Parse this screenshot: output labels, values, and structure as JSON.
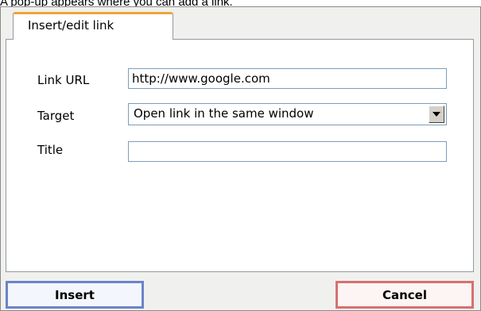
{
  "caption": "A pop-up appears where you can add a link.",
  "tabs": [
    {
      "label": "Insert/edit link",
      "active": true
    }
  ],
  "form": {
    "link_url_label": "Link URL",
    "link_url_value": "http://www.google.com",
    "target_label": "Target",
    "target_value": "Open link in the same window",
    "title_label": "Title",
    "title_value": ""
  },
  "buttons": {
    "insert_label": "Insert",
    "cancel_label": "Cancel"
  },
  "colors": {
    "active_tab_accent": "#f0a33a",
    "insert_border": "#6b84c9",
    "cancel_border": "#d77070"
  }
}
